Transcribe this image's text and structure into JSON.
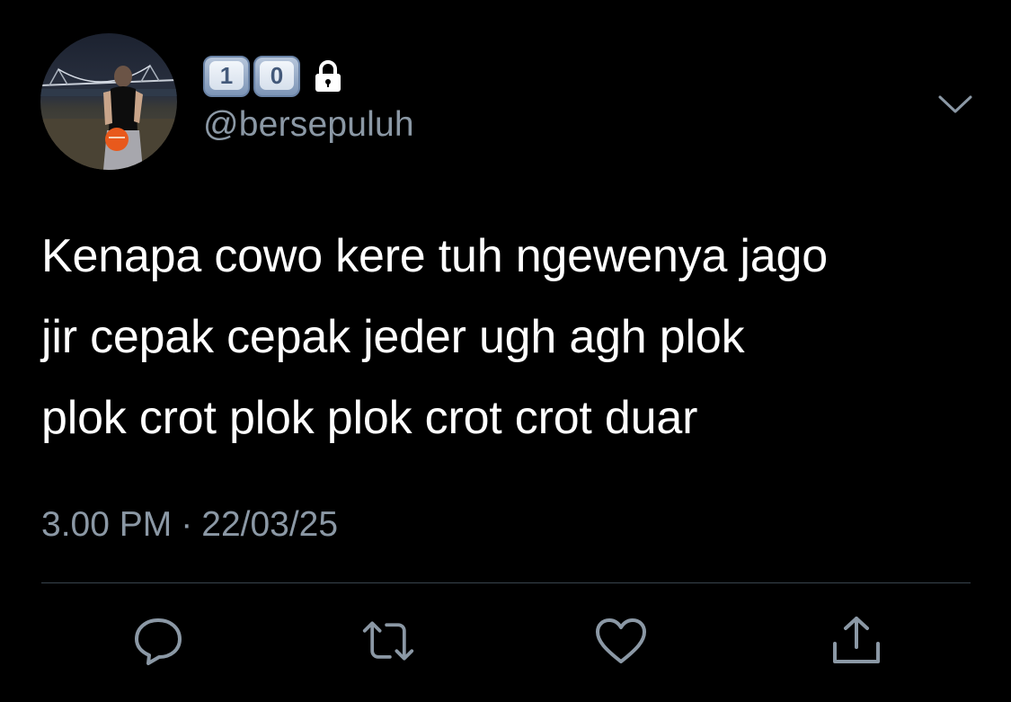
{
  "user": {
    "name_keycaps": [
      "1",
      "0"
    ],
    "handle": "@bersepuluh",
    "avatar_icon": "profile-photo",
    "protected_icon": "lock-icon"
  },
  "tweet": {
    "text_lines": [
      "Kenapa cowo kere tuh ngewenya jago",
      "jir cepak cepak jeder ugh agh plok",
      "plok crot plok plok crot crot duar"
    ],
    "time": "3.00 PM",
    "separator": "·",
    "date": "22/03/25"
  },
  "actions": [
    {
      "icon": "reply-icon"
    },
    {
      "icon": "retweet-icon"
    },
    {
      "icon": "like-icon"
    },
    {
      "icon": "share-icon"
    }
  ],
  "colors": {
    "background": "#000000",
    "text": "#ffffff",
    "secondary": "#8b98a5",
    "divider": "#38444d"
  }
}
